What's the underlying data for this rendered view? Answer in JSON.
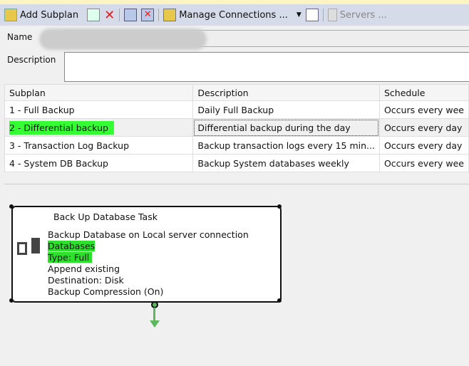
{
  "toolbar": {
    "add_subplan": "Add Subplan",
    "manage_connections": "Manage Connections ...",
    "servers": "Servers ..."
  },
  "form": {
    "name_label": "Name",
    "description_label": "Description",
    "description_value": ""
  },
  "grid": {
    "headers": [
      "Subplan",
      "Description",
      "Schedule"
    ],
    "rows": [
      {
        "subplan": "1 - Full Backup",
        "description": "Daily Full Backup",
        "schedule": "Occurs every wee"
      },
      {
        "subplan": "2 - Differential backup",
        "description": "Differential backup during the day",
        "schedule": "Occurs every day"
      },
      {
        "subplan": "3 - Transaction Log Backup",
        "description": "Backup transaction logs every 15 min...",
        "schedule": "Occurs every day"
      },
      {
        "subplan": "4 - System DB Backup",
        "description": "Backup System databases weekly",
        "schedule": "Occurs every wee"
      }
    ]
  },
  "task": {
    "title": "Back Up Database Task",
    "lines": [
      "Backup Database on Local server connection",
      "Databases",
      "Type: Full",
      "Append existing",
      "Destination: Disk",
      "Backup Compression (On)"
    ]
  },
  "colors": {
    "highlight": "#2ce02c",
    "connector": "#5cb85c"
  }
}
